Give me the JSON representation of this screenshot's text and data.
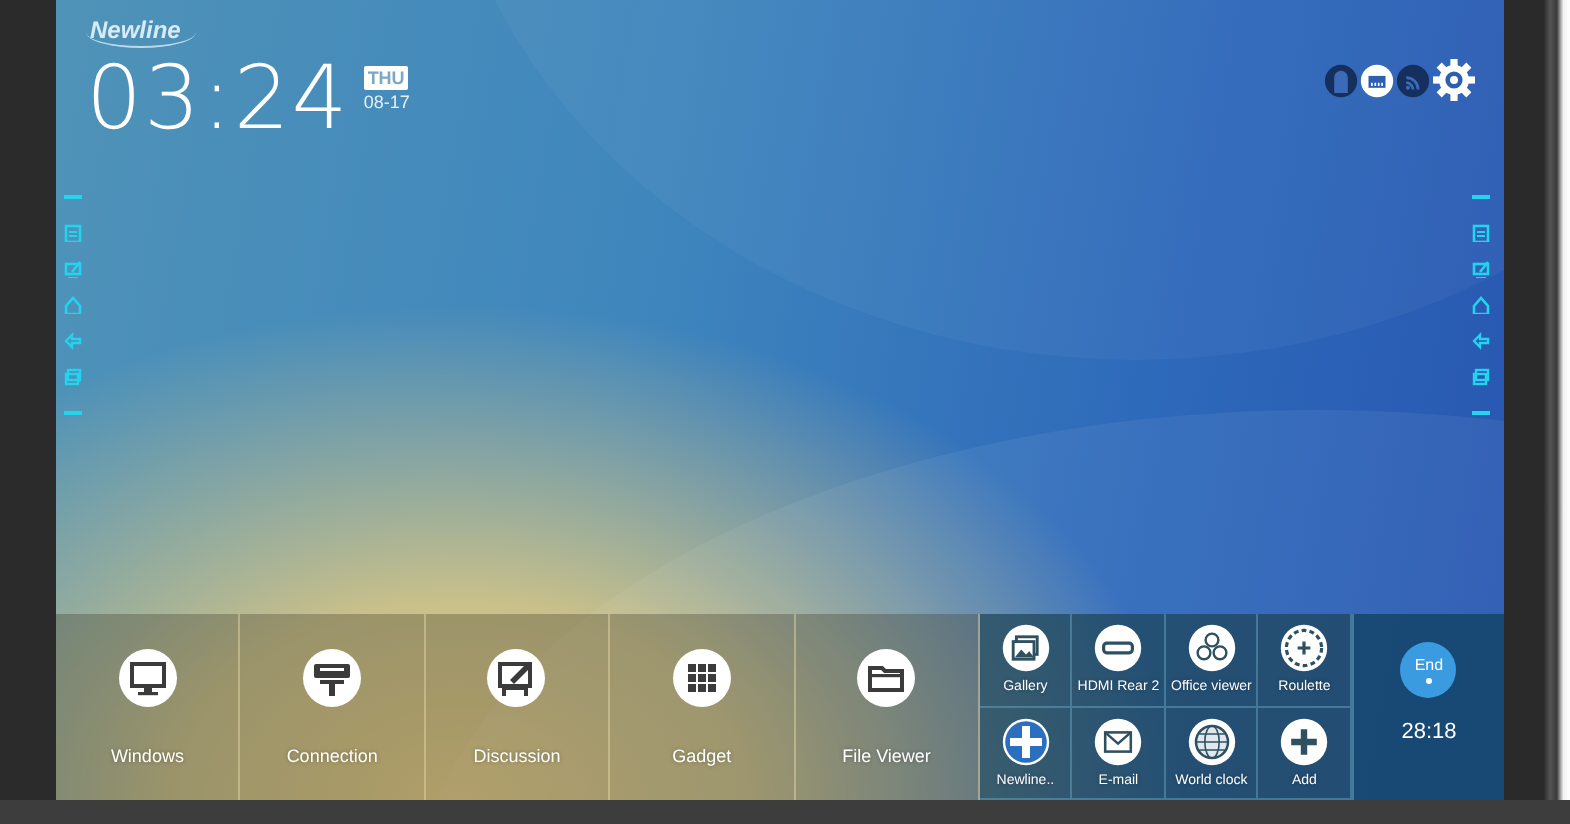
{
  "header": {
    "logo": "Newline",
    "time": "03:24",
    "day": "THU",
    "date": "08-17"
  },
  "launcher": {
    "tiles": [
      {
        "label": "Windows"
      },
      {
        "label": "Connection"
      },
      {
        "label": "Discussion"
      },
      {
        "label": "Gadget"
      },
      {
        "label": "File Viewer"
      }
    ],
    "shortcuts": [
      {
        "label": "Gallery"
      },
      {
        "label": "HDMI Rear 2"
      },
      {
        "label": "Office viewer"
      },
      {
        "label": "Roulette"
      },
      {
        "label": "Newline.."
      },
      {
        "label": "E-mail"
      },
      {
        "label": "World clock"
      },
      {
        "label": "Add"
      }
    ],
    "end_button": "End",
    "timer": "28:18"
  }
}
